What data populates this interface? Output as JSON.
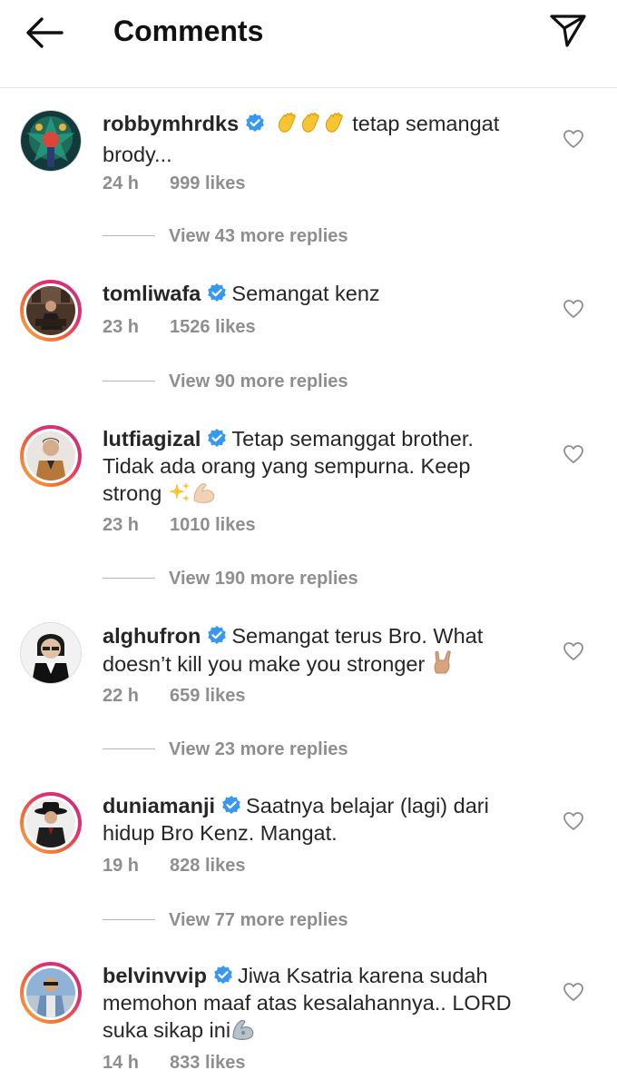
{
  "header": {
    "title": "Comments",
    "back_icon": "arrow-left-icon",
    "send_icon": "paper-plane-icon"
  },
  "colors": {
    "verified": "#3897f0",
    "meta": "#8e8e8e",
    "ring_start": "#f9b24a",
    "ring_end": "#c13584"
  },
  "comments": [
    {
      "username": "robbymhrdks",
      "text_before": "",
      "text": "tetap semangat brody...",
      "time": "24 h",
      "likes": "999 likes",
      "replies": "View 43 more replies"
    },
    {
      "username": "tomliwafa",
      "text": "Semangat kenz",
      "time": "23 h",
      "likes": "1526 likes",
      "replies": "View 90 more replies"
    },
    {
      "username": "lutfiagizal",
      "text": "Tetap semanggat brother. Tidak ada orang yang sempurna. Keep strong",
      "time": "23 h",
      "likes": "1010 likes",
      "replies": "View 190 more replies"
    },
    {
      "username": "alghufron",
      "text": "Semangat terus Bro. What doesn’t kill you make you stronger",
      "time": "22 h",
      "likes": "659 likes",
      "replies": "View 23 more replies"
    },
    {
      "username": "duniamanji",
      "text": "Saatnya belajar (lagi) dari hidup Bro Kenz. Mangat.",
      "time": "19 h",
      "likes": "828 likes",
      "replies": "View 77 more replies"
    },
    {
      "username": "belvinvvip",
      "text": "Jiwa Ksatria karena sudah memohon maaf atas kesalahannya.. LORD suka sikap ini",
      "time": "14 h",
      "likes": "833 likes"
    }
  ]
}
